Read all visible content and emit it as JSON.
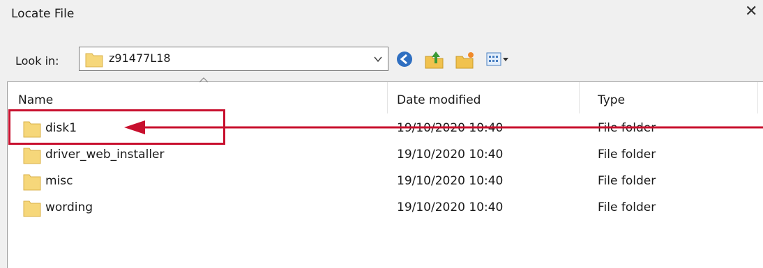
{
  "dialog": {
    "title": "Locate File"
  },
  "lookin": {
    "label": "Look in:",
    "value": "z91477L18"
  },
  "columns": {
    "name": "Name",
    "date": "Date modified",
    "type": "Type"
  },
  "files": [
    {
      "name": "disk1",
      "date": "19/10/2020 10:40",
      "type": "File folder"
    },
    {
      "name": "driver_web_installer",
      "date": "19/10/2020 10:40",
      "type": "File folder"
    },
    {
      "name": "misc",
      "date": "19/10/2020 10:40",
      "type": "File folder"
    },
    {
      "name": "wording",
      "date": "19/10/2020 10:40",
      "type": "File folder"
    }
  ],
  "annotation_color": "#c8102e",
  "icons": [
    "close-icon",
    "folder-icon",
    "chevron-down-icon",
    "back-icon",
    "up-folder-icon",
    "new-folder-icon",
    "view-menu-icon"
  ]
}
